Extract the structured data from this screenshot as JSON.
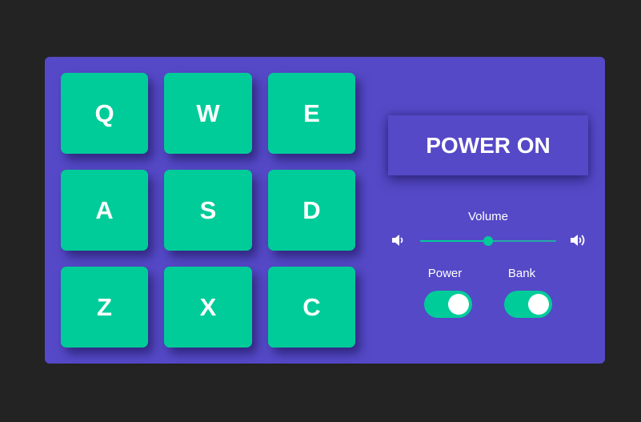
{
  "pads": [
    {
      "key": "Q"
    },
    {
      "key": "W"
    },
    {
      "key": "E"
    },
    {
      "key": "A"
    },
    {
      "key": "S"
    },
    {
      "key": "D"
    },
    {
      "key": "Z"
    },
    {
      "key": "X"
    },
    {
      "key": "C"
    }
  ],
  "display": {
    "text": "POWER ON"
  },
  "volume": {
    "label": "Volume",
    "value": 0.5
  },
  "switches": {
    "power": {
      "label": "Power",
      "on": true
    },
    "bank": {
      "label": "Bank",
      "on": true
    }
  },
  "colors": {
    "background": "#232323",
    "panel": "#5549c7",
    "pad": "#00cc99",
    "text": "#ffffff",
    "track": "#27a9a9"
  },
  "icons": {
    "volume_low": "volume-low-icon",
    "volume_high": "volume-high-icon"
  }
}
